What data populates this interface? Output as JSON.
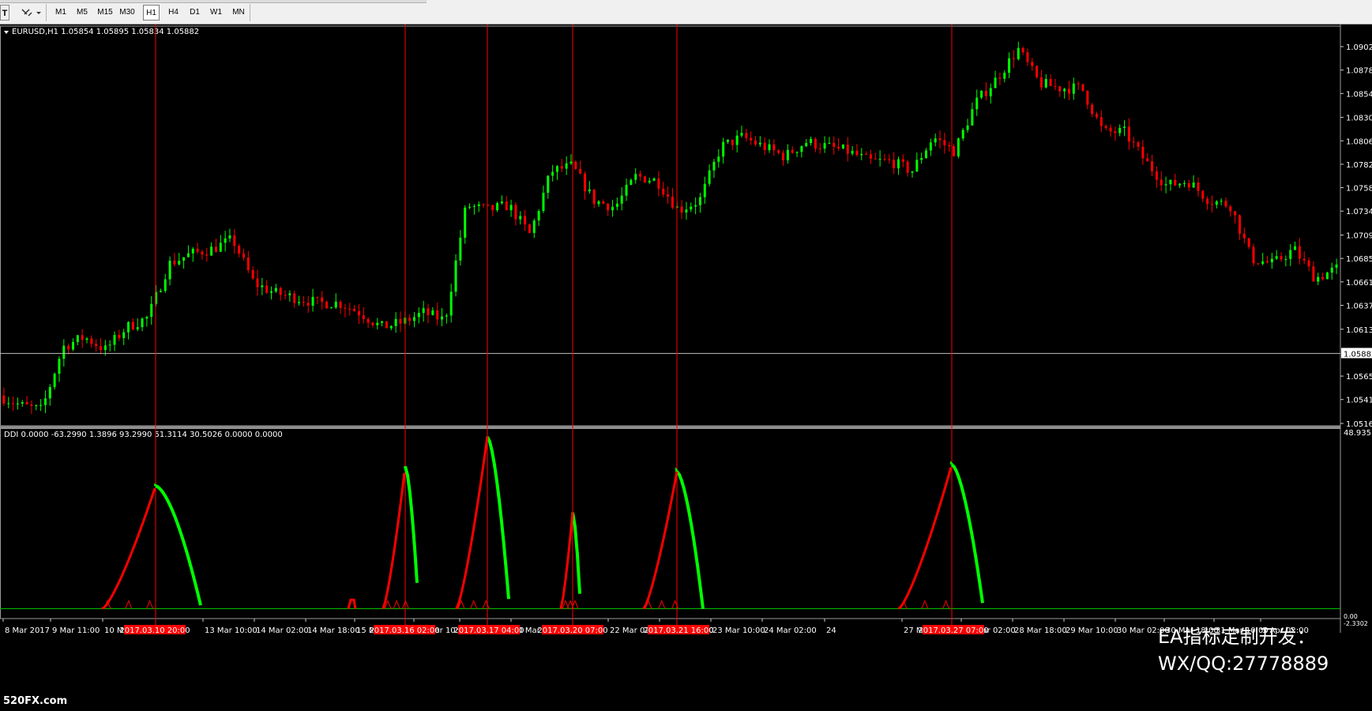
{
  "toolbar": {
    "text_tool": "T",
    "shapes_tool": "shapes-icon",
    "timeframes": [
      {
        "label": "M1",
        "active": false
      },
      {
        "label": "M5",
        "active": false
      },
      {
        "label": "M15",
        "active": false
      },
      {
        "label": "M30",
        "active": false
      },
      {
        "label": "H1",
        "active": true
      },
      {
        "label": "H4",
        "active": false
      },
      {
        "label": "D1",
        "active": false
      },
      {
        "label": "W1",
        "active": false
      },
      {
        "label": "MN",
        "active": false
      }
    ]
  },
  "main_chart": {
    "header": "EURUSD,H1  1.05854 1.05895 1.05834 1.05882",
    "current_price": "1.05882",
    "price_axis": [
      "1.09025",
      "1.08785",
      "1.08545",
      "1.08300",
      "1.08060",
      "1.07820",
      "1.07580",
      "1.07340",
      "1.07095",
      "1.06855",
      "1.06615",
      "1.06375",
      "1.06130",
      "1.05650",
      "1.05410",
      "1.05165"
    ]
  },
  "indicator": {
    "header": "DDI 0.0000 -63.2990 1.3896 93.2990 51.3114 30.5026 0.0000 0.0000",
    "axis_top": "48.935",
    "axis_zero": "0.00",
    "axis_bottom": "-2.3302"
  },
  "time_axis": {
    "labels": [
      "8 Mar 2017",
      "9 Mar 11:00",
      "10 Mar",
      "13 Mar 10:00",
      "14 Mar 02:00",
      "14 Mar 18:00",
      "15 Ma",
      "16 Mar 10:00",
      "17 Mar 10:",
      "20 Mar 18:",
      "22 Mar 02:00",
      "22 Mar 18:00",
      "23 Mar 10:00",
      "24 Mar 02:00",
      "24",
      "27 Mar 10:00",
      "28 Mar 02:00",
      "28 Mar 18:00",
      "29 Mar 10:00",
      "30 Mar 02:00",
      "30 Mar 18:00",
      "31 Mar 10:00",
      "3 Apr 02:00"
    ],
    "markers": [
      "2017.03.10 20:00",
      "2017.03.16 02:00",
      "2017.03.17 04:00",
      "2017.03.20 07:00",
      "2017.03.21 16:00",
      "2017.03.27 07:00"
    ]
  },
  "watermark": {
    "line1": "EA指标定制开发：",
    "line2": "WX/QQ:27778889",
    "logo": "520FX.com"
  },
  "chart_data": {
    "type": "candlestick",
    "symbol": "EURUSD",
    "timeframe": "H1",
    "ylim": [
      1.05165,
      1.09025
    ],
    "series": [
      {
        "name": "EURUSD",
        "values": [
          1.0545,
          1.0535,
          1.053,
          1.0595,
          1.0605,
          1.0592,
          1.0615,
          1.0625,
          1.068,
          1.069,
          1.0695,
          1.0705,
          1.066,
          1.065,
          1.0645,
          1.064,
          1.064,
          1.063,
          1.0615,
          1.062,
          1.063,
          1.0622,
          1.074,
          1.0735,
          1.074,
          1.071,
          1.0775,
          1.078,
          1.0745,
          1.0738,
          1.077,
          1.0765,
          1.0735,
          1.0745,
          1.08,
          1.081,
          1.08,
          1.079,
          1.0805,
          1.08,
          1.0795,
          1.0785,
          1.0785,
          1.0775,
          1.081,
          1.0795,
          1.0845,
          1.087,
          1.09,
          1.0865,
          1.086,
          1.086,
          1.0815,
          1.0815,
          1.0785,
          1.076,
          1.0765,
          1.0745,
          1.074,
          1.0685,
          1.068,
          1.0695,
          1.0665,
          1.0675
        ]
      }
    ],
    "indicator": {
      "name": "DDI",
      "ylim": [
        -2.3302,
        48.935
      ],
      "peaks": [
        34.5,
        40.0,
        48.3,
        27.0,
        38.5,
        40.5
      ]
    }
  }
}
